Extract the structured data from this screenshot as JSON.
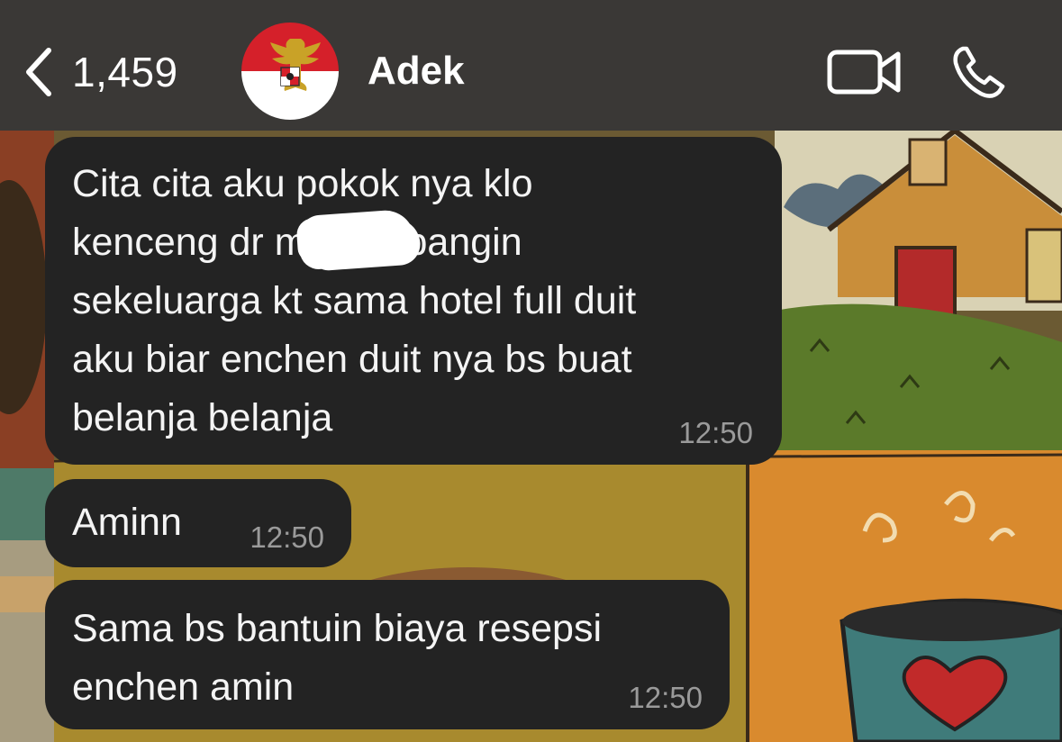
{
  "header": {
    "back_count": "1,459",
    "contact_name": "Adek",
    "icons": [
      "chevron-left-icon",
      "garuda-emblem",
      "video-camera-icon",
      "phone-icon"
    ]
  },
  "messages": [
    {
      "text": "Cita cita aku pokok nya klo\nkenceng dr               mao terbangin\nsekeluarga kt sama hotel full duit\naku biar enchen duit nya bs buat\nbelanja belanja",
      "time": "12:50",
      "redacted": true
    },
    {
      "text": "Aminn",
      "time": "12:50"
    },
    {
      "text": "Sama bs bantuin biaya resepsi\nenchen amin",
      "time": "12:50"
    }
  ],
  "colors": {
    "header_bg": "#3a3836",
    "bubble_bg": "#232323",
    "text": "#f4f4f4",
    "time_text": "#9a9a9a"
  }
}
